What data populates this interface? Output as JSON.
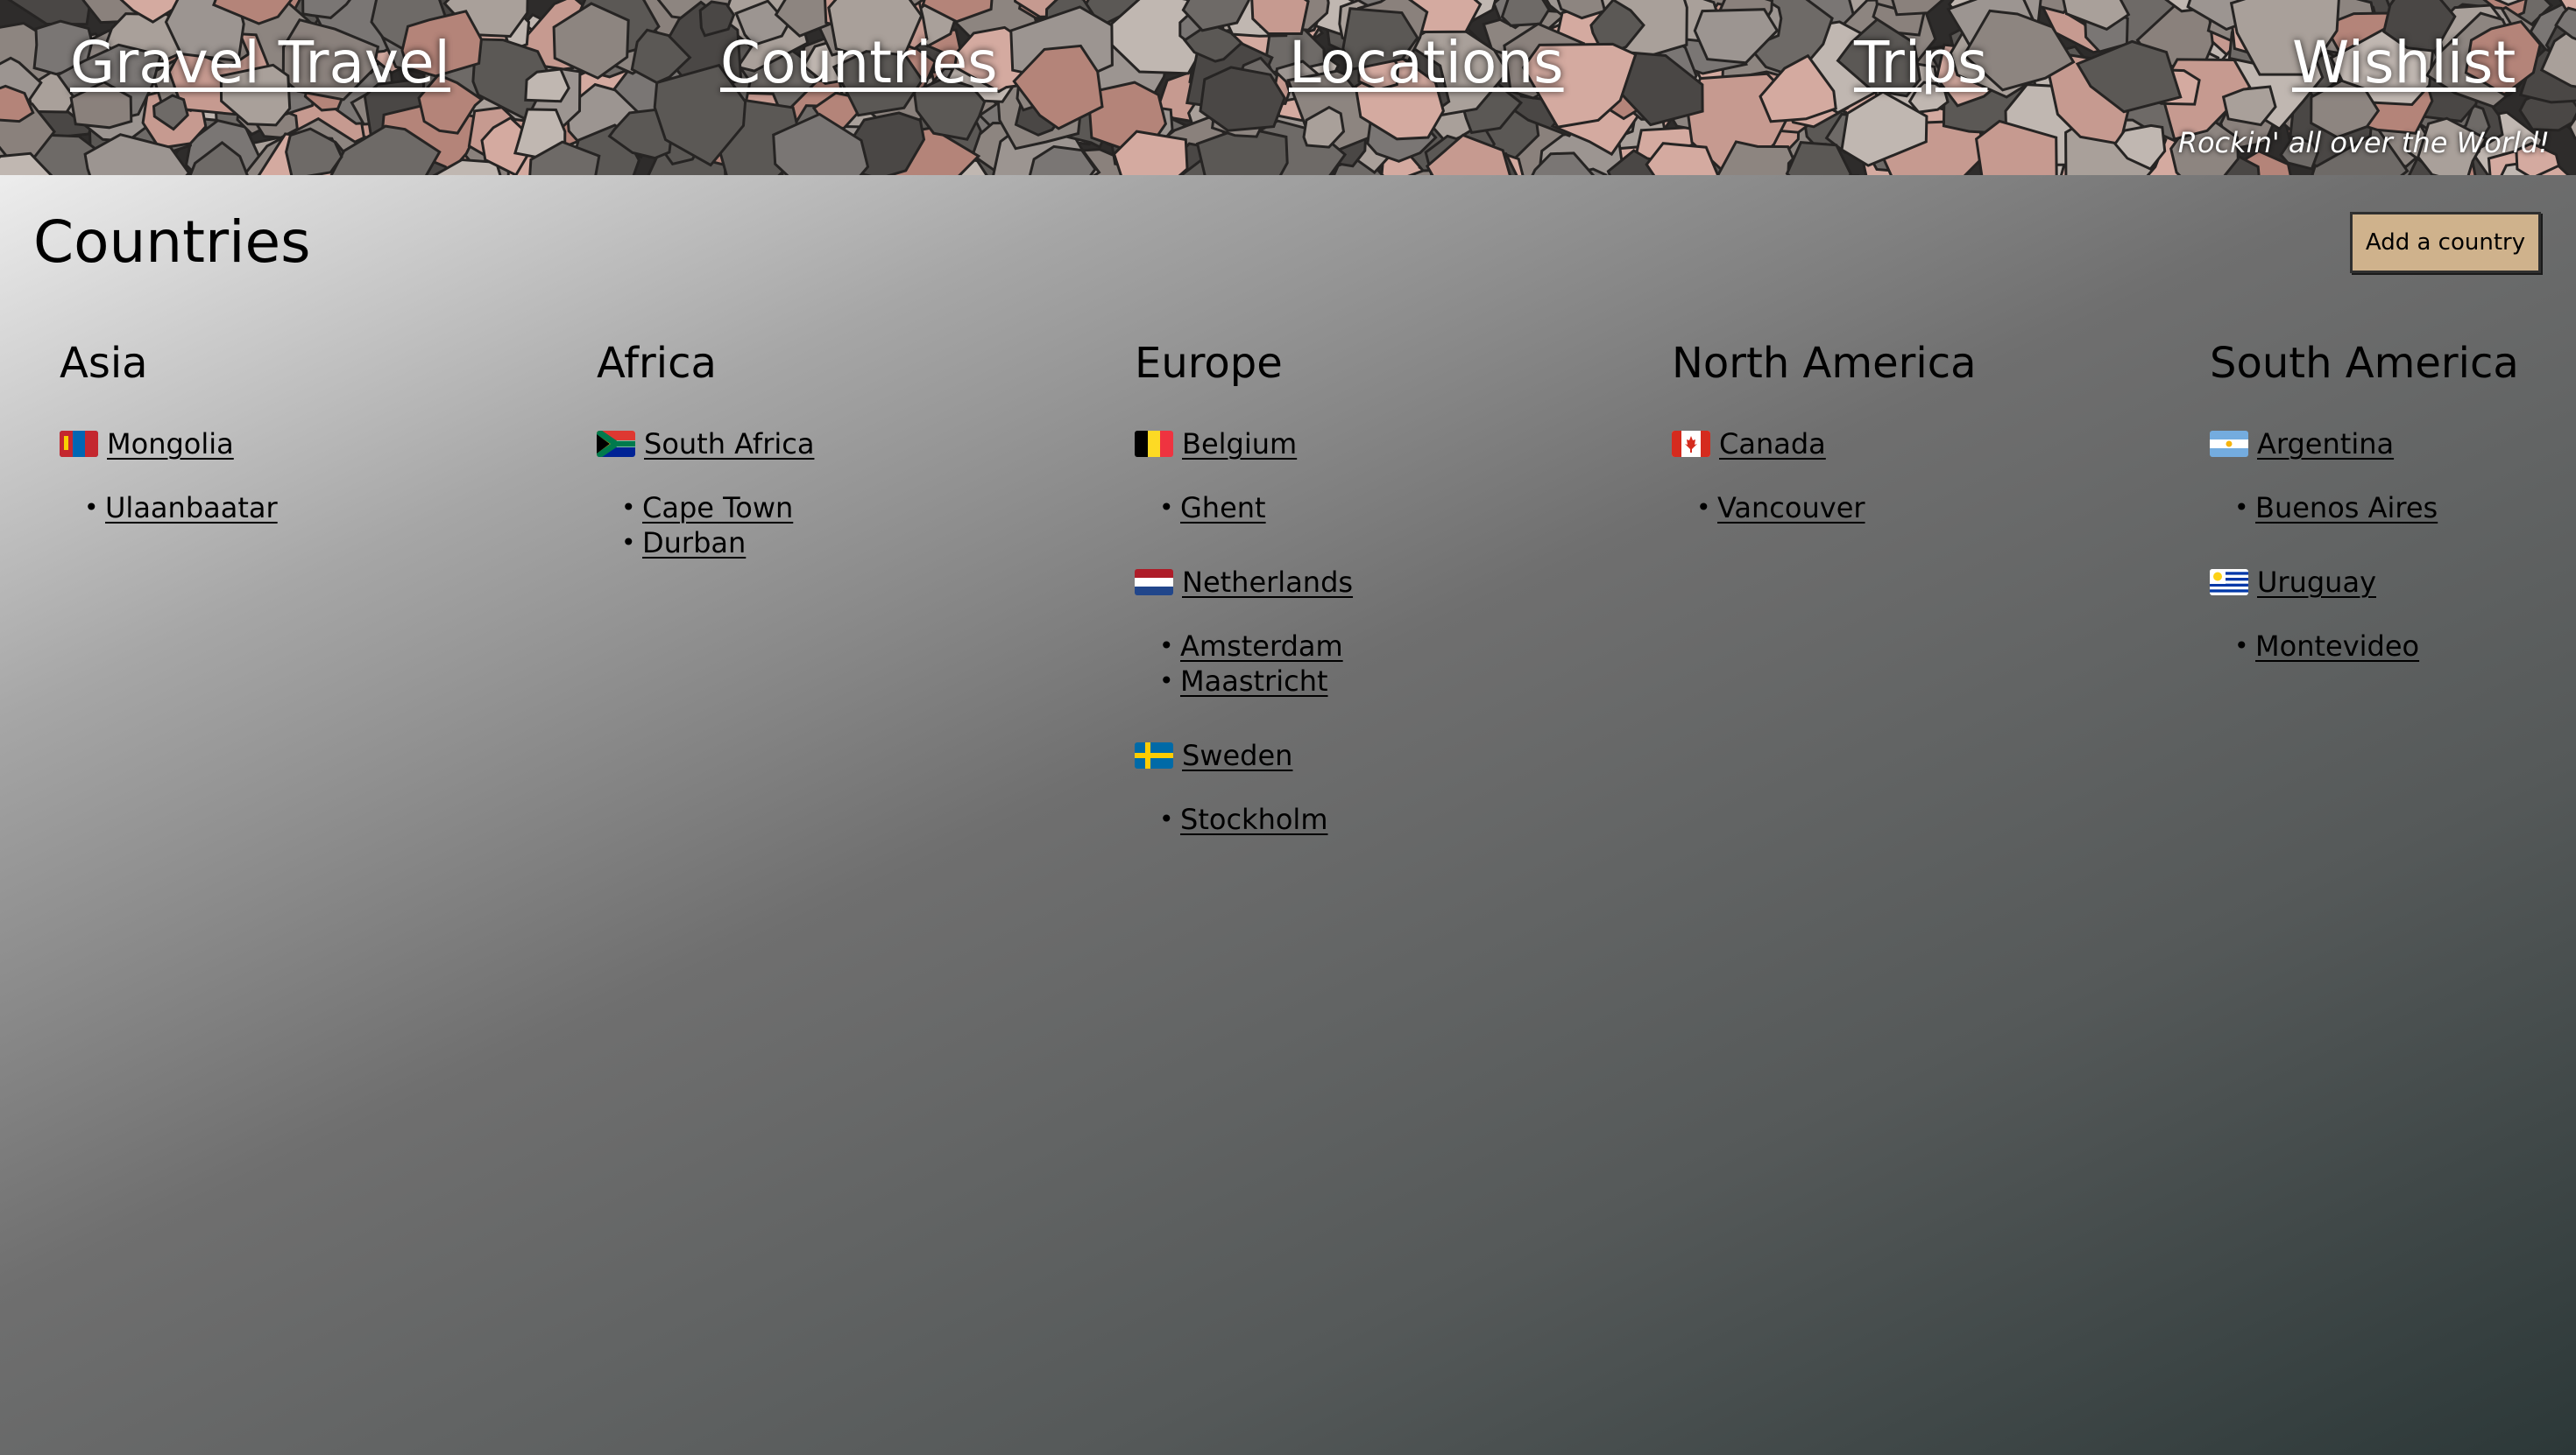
{
  "header": {
    "nav": {
      "brand": "Gravel Travel",
      "countries": "Countries",
      "locations": "Locations",
      "trips": "Trips",
      "wishlist": "Wishlist"
    },
    "tagline": "Rockin' all over the World!"
  },
  "page": {
    "title": "Countries",
    "add_button": "Add a country"
  },
  "continents": [
    {
      "name": "Asia",
      "countries": [
        {
          "name": "Mongolia",
          "flag": "mongolia-flag-icon",
          "cities": [
            "Ulaanbaatar"
          ]
        }
      ]
    },
    {
      "name": "Africa",
      "countries": [
        {
          "name": "South Africa",
          "flag": "south-africa-flag-icon",
          "cities": [
            "Cape Town",
            "Durban"
          ]
        }
      ]
    },
    {
      "name": "Europe",
      "countries": [
        {
          "name": "Belgium",
          "flag": "belgium-flag-icon",
          "cities": [
            "Ghent"
          ]
        },
        {
          "name": "Netherlands",
          "flag": "netherlands-flag-icon",
          "cities": [
            "Amsterdam",
            "Maastricht"
          ]
        },
        {
          "name": "Sweden",
          "flag": "sweden-flag-icon",
          "cities": [
            "Stockholm"
          ]
        }
      ]
    },
    {
      "name": "North America",
      "countries": [
        {
          "name": "Canada",
          "flag": "canada-flag-icon",
          "cities": [
            "Vancouver"
          ]
        }
      ]
    },
    {
      "name": "South America",
      "countries": [
        {
          "name": "Argentina",
          "flag": "argentina-flag-icon",
          "cities": [
            "Buenos Aires"
          ]
        },
        {
          "name": "Uruguay",
          "flag": "uruguay-flag-icon",
          "cities": [
            "Montevideo"
          ]
        }
      ]
    }
  ]
}
